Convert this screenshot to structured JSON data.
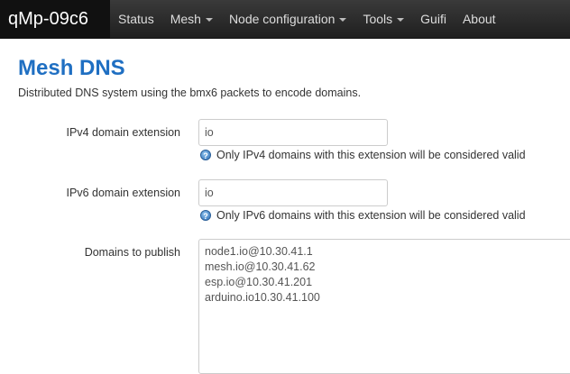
{
  "navbar": {
    "brand": "qMp-09c6",
    "items": [
      {
        "label": "Status",
        "dropdown": false
      },
      {
        "label": "Mesh",
        "dropdown": true
      },
      {
        "label": "Node configuration",
        "dropdown": true
      },
      {
        "label": "Tools",
        "dropdown": true
      },
      {
        "label": "Guifi",
        "dropdown": false
      },
      {
        "label": "About",
        "dropdown": false
      }
    ]
  },
  "page": {
    "title": "Mesh DNS",
    "description": "Distributed DNS system using the bmx6 packets to encode domains."
  },
  "form": {
    "ipv4": {
      "label": "IPv4 domain extension",
      "value": "io",
      "hint": "Only IPv4 domains with this extension will be considered valid"
    },
    "ipv6": {
      "label": "IPv6 domain extension",
      "value": "io",
      "hint": "Only IPv6 domains with this extension will be considered valid"
    },
    "domains": {
      "label": "Domains to publish",
      "lines": [
        "node1.io@10.30.41.1",
        "mesh.io@10.30.41.62",
        "esp.io@10.30.41.201",
        "arduino.io10.30.41.100"
      ]
    }
  },
  "colors": {
    "navbar_bg": "#2b2b2b",
    "title": "#1f6fc2",
    "help_icon": "#2c6fb7"
  },
  "icons": {
    "help": "help-icon",
    "caret": "caret-down-icon"
  }
}
